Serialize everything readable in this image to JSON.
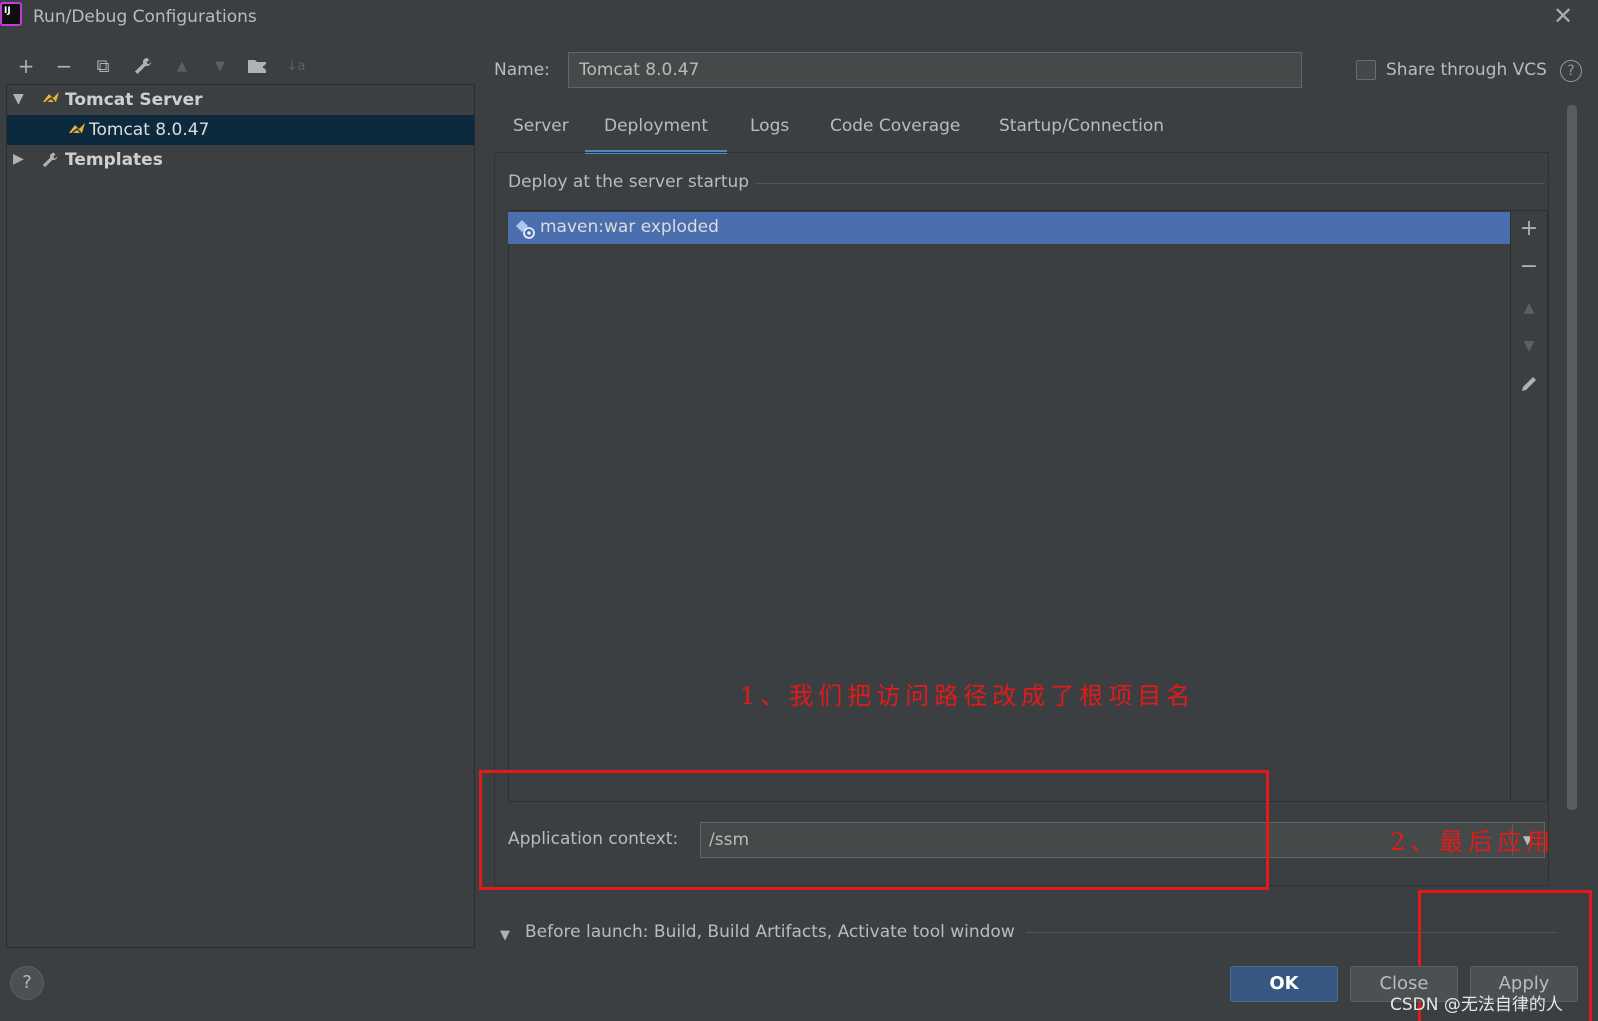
{
  "window": {
    "title": "Run/Debug Configurations",
    "app_icon_text": "IJ"
  },
  "toolbar": {
    "add": "+",
    "remove": "−",
    "copy": "⧉",
    "edit": "🔧",
    "move_up": "▲",
    "move_down": "▼",
    "folder": "📁",
    "sort": "↓a"
  },
  "tree": {
    "items": [
      {
        "label": "Tomcat Server",
        "expanded": true,
        "icon": "tomcat-icon"
      },
      {
        "label": "Tomcat 8.0.47",
        "selected": true,
        "icon": "tomcat-icon"
      },
      {
        "label": "Templates",
        "expanded": false,
        "icon": "wrench-icon"
      }
    ]
  },
  "form": {
    "name_label": "Name:",
    "name_value": "Tomcat 8.0.47",
    "share_label": "Share through VCS",
    "share_checked": false,
    "help": "?"
  },
  "tabs": [
    {
      "label": "Server"
    },
    {
      "label": "Deployment",
      "active": true
    },
    {
      "label": "Logs"
    },
    {
      "label": "Code Coverage"
    },
    {
      "label": "Startup/Connection"
    }
  ],
  "deployment": {
    "section_title": "Deploy at the server startup",
    "items": [
      "maven:war exploded"
    ],
    "context_label": "Application context:",
    "context_value": "/ssm"
  },
  "annotations": {
    "note1": "1、我们把访问路径改成了根项目名",
    "note2": "2、最后应用"
  },
  "before_launch": {
    "label": "Before launch: Build, Build Artifacts, Activate tool window"
  },
  "buttons": {
    "ok": "OK",
    "close": "Close",
    "apply": "Apply",
    "help": "?"
  },
  "watermark": "CSDN @无法自律的人",
  "colors": {
    "accent": "#4a88c7",
    "selection": "#4b6eaf",
    "annotation": "#e11a1a",
    "ok_button": "#365880"
  }
}
